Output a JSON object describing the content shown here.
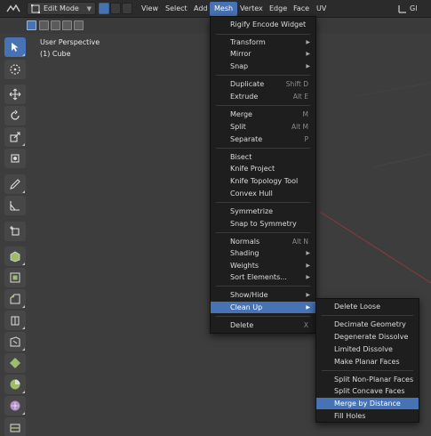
{
  "header": {
    "mode": "Edit Mode",
    "menus": [
      "View",
      "Select",
      "Add",
      "Mesh",
      "Vertex",
      "Edge",
      "Face",
      "UV"
    ],
    "right_label": "Gl"
  },
  "viewport": {
    "perspective": "User Perspective",
    "object": "(1) Cube"
  },
  "mesh_menu": {
    "rigify": "Rigify Encode Widget",
    "transform": "Transform",
    "mirror": "Mirror",
    "snap": "Snap",
    "duplicate": "Duplicate",
    "duplicate_sc": "Shift D",
    "extrude": "Extrude",
    "extrude_sc": "Alt E",
    "merge": "Merge",
    "merge_sc": "M",
    "split": "Split",
    "split_sc": "Alt M",
    "separate": "Separate",
    "separate_sc": "P",
    "bisect": "Bisect",
    "knife_project": "Knife Project",
    "knife_topology": "Knife Topology Tool",
    "convex_hull": "Convex Hull",
    "symmetrize": "Symmetrize",
    "snap_symmetry": "Snap to Symmetry",
    "normals": "Normals",
    "normals_sc": "Alt N",
    "shading": "Shading",
    "weights": "Weights",
    "sort_elements": "Sort Elements...",
    "show_hide": "Show/Hide",
    "clean_up": "Clean Up",
    "delete": "Delete",
    "delete_sc": "X"
  },
  "cleanup_menu": {
    "delete_loose": "Delete Loose",
    "decimate": "Decimate Geometry",
    "degenerate": "Degenerate Dissolve",
    "limited": "Limited Dissolve",
    "planar": "Make Planar Faces",
    "split_nonplanar": "Split Non-Planar Faces",
    "split_concave": "Split Concave Faces",
    "merge_distance": "Merge by Distance",
    "fill_holes": "Fill Holes"
  },
  "colors": {
    "accent": "#4772b3",
    "menu_bg": "#1e1e1e",
    "viewport_bg": "#3d3d3d"
  }
}
